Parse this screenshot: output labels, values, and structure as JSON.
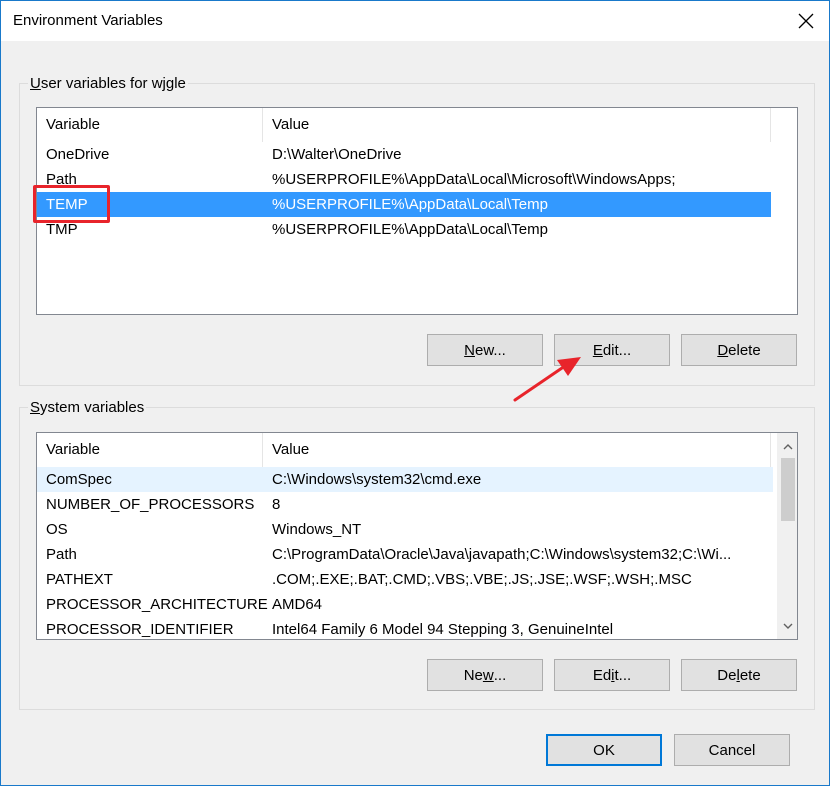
{
  "window": {
    "title": "Environment Variables",
    "close_icon": "close-icon"
  },
  "user_group": {
    "legend_underlined": "U",
    "legend_rest": "ser variables for wjgle",
    "columns": [
      "Variable",
      "Value"
    ],
    "rows": [
      {
        "variable": "OneDrive",
        "value": "D:\\Walter\\OneDrive"
      },
      {
        "variable": "Path",
        "value": "%USERPROFILE%\\AppData\\Local\\Microsoft\\WindowsApps;"
      },
      {
        "variable": "TEMP",
        "value": "%USERPROFILE%\\AppData\\Local\\Temp"
      },
      {
        "variable": "TMP",
        "value": "%USERPROFILE%\\AppData\\Local\\Temp"
      }
    ],
    "selected_index": 2,
    "buttons": {
      "new_u": "N",
      "new_rest": "ew...",
      "edit_u": "E",
      "edit_rest": "dit...",
      "delete_u": "D",
      "delete_rest": "elete"
    }
  },
  "system_group": {
    "legend_underlined": "S",
    "legend_rest": "ystem variables",
    "columns": [
      "Variable",
      "Value"
    ],
    "rows": [
      {
        "variable": "ComSpec",
        "value": "C:\\Windows\\system32\\cmd.exe"
      },
      {
        "variable": "NUMBER_OF_PROCESSORS",
        "value": "8"
      },
      {
        "variable": "OS",
        "value": "Windows_NT"
      },
      {
        "variable": "Path",
        "value": "C:\\ProgramData\\Oracle\\Java\\javapath;C:\\Windows\\system32;C:\\Wi..."
      },
      {
        "variable": "PATHEXT",
        "value": ".COM;.EXE;.BAT;.CMD;.VBS;.VBE;.JS;.JSE;.WSF;.WSH;.MSC"
      },
      {
        "variable": "PROCESSOR_ARCHITECTURE",
        "value": "AMD64"
      },
      {
        "variable": "PROCESSOR_IDENTIFIER",
        "value": "Intel64 Family 6 Model 94 Stepping 3, GenuineIntel"
      }
    ],
    "buttons": {
      "new_u": "w",
      "new_pre": "Ne",
      "new_rest": "...",
      "edit_u": "i",
      "edit_pre": "Ed",
      "edit_rest": "t...",
      "delete_u": "l",
      "delete_pre": "De",
      "delete_rest": "ete"
    }
  },
  "footer": {
    "ok": "OK",
    "cancel": "Cancel"
  },
  "colors": {
    "selection": "#3399ff",
    "annotation": "#e8242b",
    "default_button_border": "#0078d7"
  }
}
